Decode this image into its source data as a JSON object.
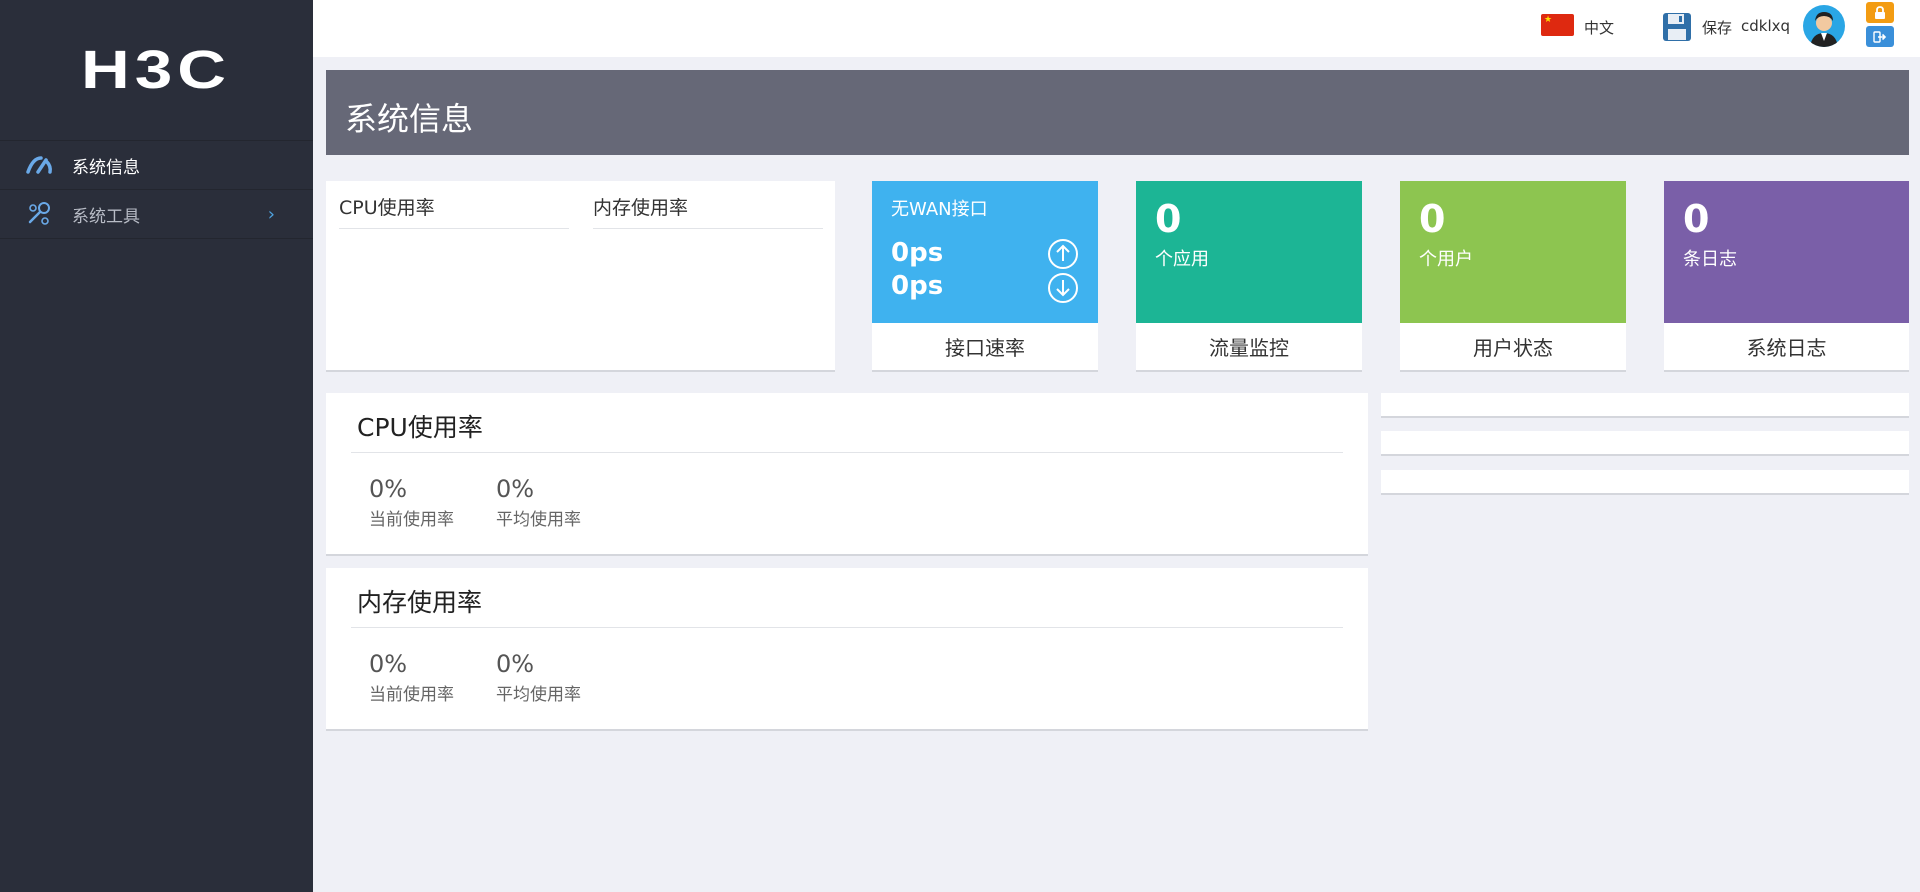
{
  "sidebar": {
    "logo": "H3C",
    "items": [
      {
        "label": "系统信息"
      },
      {
        "label": "系统工具"
      }
    ]
  },
  "topbar": {
    "language": "中文",
    "save_label": "保存",
    "username": "cdklxq"
  },
  "page": {
    "title": "系统信息"
  },
  "usage_box": {
    "cpu_label": "CPU使用率",
    "mem_label": "内存使用率"
  },
  "cards": {
    "wan": {
      "title": "无WAN接口",
      "up_rate": "0ps",
      "down_rate": "0ps",
      "footer": "接口速率",
      "color": "#3fb2ef"
    },
    "traffic": {
      "value": "0",
      "label": "个应用",
      "footer": "流量监控",
      "color": "#1cb595"
    },
    "users": {
      "value": "0",
      "label": "个用户",
      "footer": "用户状态",
      "color": "#8dc550"
    },
    "logs": {
      "value": "0",
      "label": "条日志",
      "footer": "系统日志",
      "color": "#7a5fa8"
    }
  },
  "cpu_panel": {
    "title": "CPU使用率",
    "current_value": "0%",
    "current_label": "当前使用率",
    "average_value": "0%",
    "average_label": "平均使用率"
  },
  "mem_panel": {
    "title": "内存使用率",
    "current_value": "0%",
    "current_label": "当前使用率",
    "average_value": "0%",
    "average_label": "平均使用率"
  }
}
